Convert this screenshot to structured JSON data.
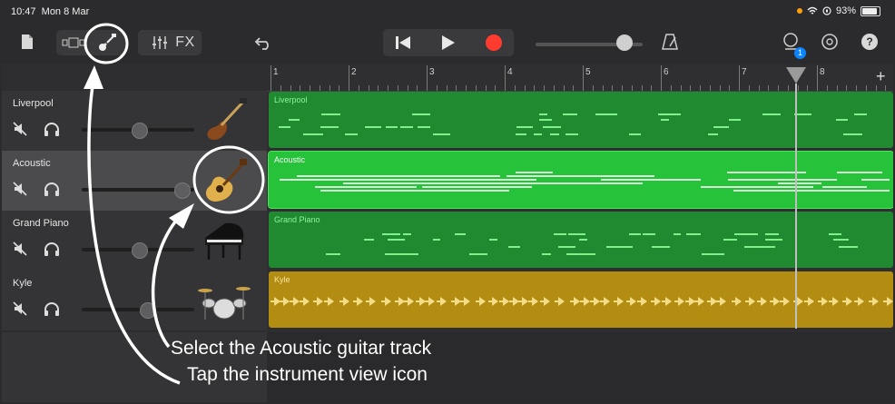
{
  "status": {
    "time": "10:47",
    "date": "Mon 8 Mar",
    "battery": "93%"
  },
  "toolbar": {
    "fx_label": "FX",
    "notifications_count": "1",
    "icons": [
      "document-icon",
      "browser-view-icon",
      "instrument-view-icon",
      "mixer-icon",
      "undo-icon",
      "skip-back-icon",
      "play-icon",
      "record-icon",
      "metronome-icon",
      "loop-icon",
      "settings-icon",
      "help-icon"
    ]
  },
  "ruler": {
    "bars": [
      "1",
      "2",
      "3",
      "4",
      "5",
      "6",
      "7",
      "8"
    ]
  },
  "tracks": [
    {
      "name": "Liverpool",
      "instrument": "bass-guitar",
      "region_color": "#1f8a2f",
      "note_color": "#7ff08a",
      "volume": 0.5
    },
    {
      "name": "Acoustic",
      "instrument": "acoustic-guitar",
      "region_color": "#25c23a",
      "note_color": "#d6ffd9",
      "volume": 0.9,
      "selected": true
    },
    {
      "name": "Grand Piano",
      "instrument": "grand-piano",
      "region_color": "#1f8a2f",
      "note_color": "#7ff08a",
      "volume": 0.5
    },
    {
      "name": "Kyle",
      "instrument": "drum-kit",
      "region_color": "#b38d12",
      "note_color": "#f3dc86",
      "volume": 0.55
    }
  ],
  "captions": {
    "line1": "Select the Acoustic guitar track",
    "line2": "Tap the instrument view icon"
  }
}
